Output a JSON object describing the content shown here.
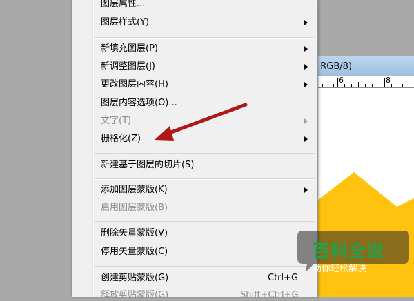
{
  "document": {
    "title_fragment": ", RGB/8)",
    "ruler_labels": [
      "6",
      "8"
    ]
  },
  "menu": {
    "items": [
      {
        "label": "图层属性...",
        "disabled": false
      },
      {
        "label": "图层样式(Y)",
        "disabled": false,
        "submenu": true
      },
      {
        "label": "新填充图层(P)",
        "disabled": false,
        "submenu": true
      },
      {
        "label": "新调整图层(J)",
        "disabled": false,
        "submenu": true
      },
      {
        "label": "更改图层内容(H)",
        "disabled": false,
        "submenu": true
      },
      {
        "label": "图层内容选项(O)...",
        "disabled": false
      },
      {
        "label": "文字(T)",
        "disabled": true,
        "submenu": true
      },
      {
        "label": "栅格化(Z)",
        "disabled": false,
        "submenu": true
      },
      {
        "label": "新建基于图层的切片(S)",
        "disabled": false
      },
      {
        "label": "添加图层蒙版(K)",
        "disabled": false,
        "submenu": true
      },
      {
        "label": "启用图层蒙版(B)",
        "disabled": true
      },
      {
        "label": "删除矢量蒙版(V)",
        "disabled": false
      },
      {
        "label": "停用矢量蒙版(C)",
        "disabled": false
      },
      {
        "label": "创建剪贴蒙版(G)",
        "disabled": false,
        "shortcut": "Ctrl+G"
      },
      {
        "label": "释放剪贴蒙版(G)",
        "disabled": true,
        "shortcut": "Shift+Ctrl+G"
      }
    ]
  },
  "watermark": {
    "main": "百科全说",
    "sub": "助你轻松解决"
  },
  "colors": {
    "annotation_arrow": "#b01818",
    "shape_fill": "#ffc20e",
    "watermark_green": "#1fa24a"
  }
}
